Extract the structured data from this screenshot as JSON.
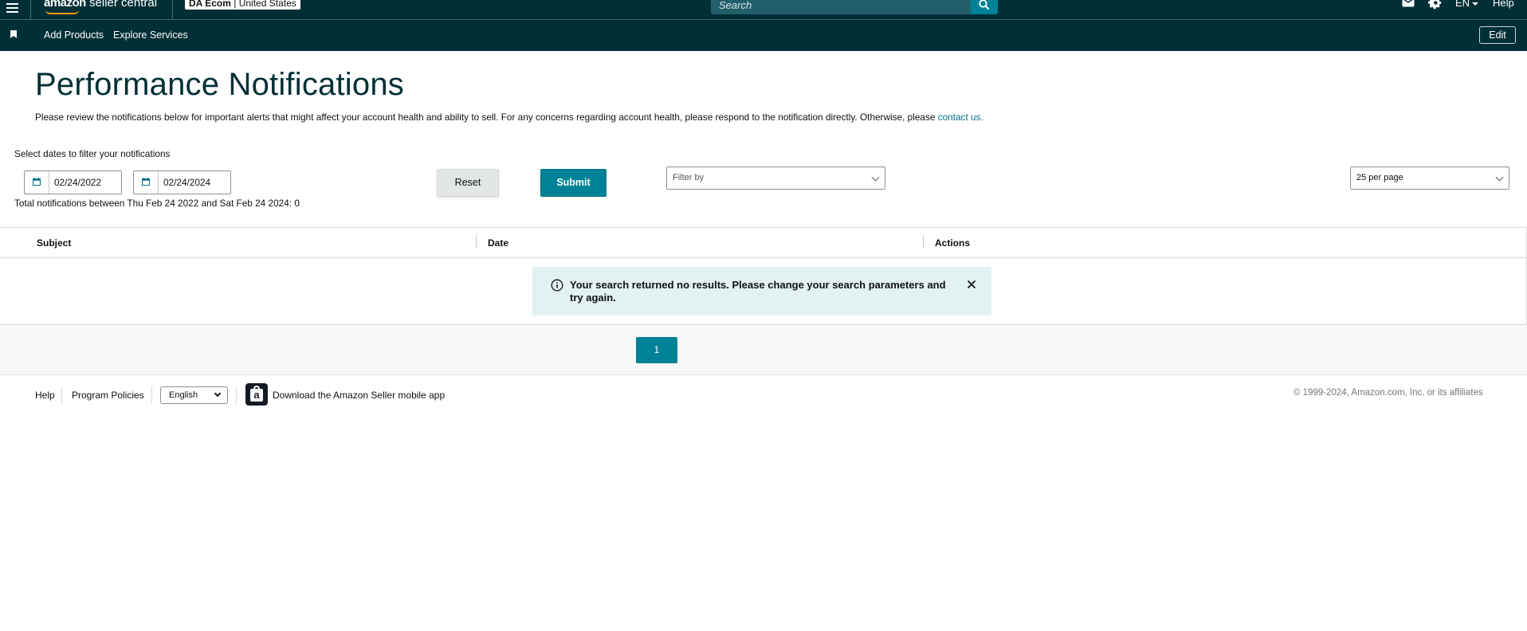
{
  "header": {
    "logo_bold": "amazon",
    "logo_text": " seller central",
    "account_name": "DA Ecom",
    "account_region": "United States",
    "search_placeholder": "Search",
    "language": "EN",
    "help": "Help"
  },
  "subnav": {
    "links": [
      "Add Products",
      "Explore Services"
    ],
    "edit": "Edit"
  },
  "page": {
    "title": "Performance Notifications",
    "description": "Please review the notifications below for important alerts that might affect your account health and ability to sell. For any concerns regarding account health, please respond to the notification directly. Otherwise, please ",
    "contact_link": "contact us.",
    "filter_prompt": "Select dates to filter your notifications",
    "start_date": "02/24/2022",
    "end_date": "02/24/2024",
    "total_text": "Total notifications between Thu Feb 24 2022 and Sat Feb 24 2024: 0",
    "reset_label": "Reset",
    "submit_label": "Submit",
    "filter_by": "Filter by",
    "per_page": "25 per page"
  },
  "table": {
    "columns": [
      "Subject",
      "Date",
      "Actions"
    ],
    "empty_message": "Your search returned no results. Please change your search parameters and try again."
  },
  "pagination": {
    "current_page": "1"
  },
  "footer": {
    "help": "Help",
    "program_policies": "Program Policies",
    "language_selected": "English",
    "app_download": "Download the Amazon Seller mobile app",
    "copyright": "© 1999-2024, Amazon.com, Inc. or its affiliates"
  },
  "colors": {
    "header_bg": "#002f36",
    "accent": "#008296",
    "link": "#007185",
    "alert_bg": "#e3f1f3",
    "logo_smile": "#ff9900"
  },
  "icons": {
    "menu": "hamburger-menu-icon",
    "search": "search-icon",
    "mail": "mail-icon",
    "settings": "gear-icon",
    "bookmark": "bookmark-icon",
    "calendar": "calendar-icon",
    "info": "info-icon",
    "close": "close-icon",
    "app": "amazon-app-icon"
  }
}
